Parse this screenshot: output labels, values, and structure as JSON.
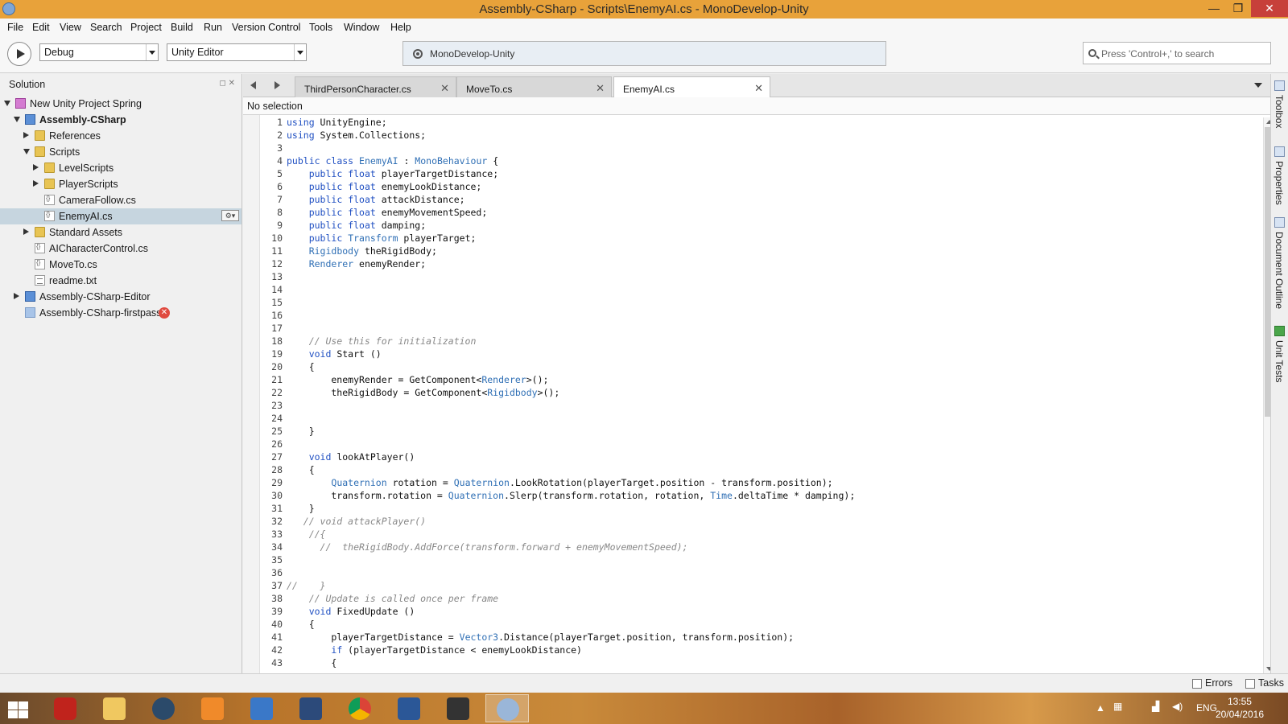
{
  "window": {
    "title": "Assembly-CSharp - Scripts\\EnemyAI.cs - MonoDevelop-Unity",
    "minimize": "—",
    "maximize": "❐",
    "close": "✕"
  },
  "menu": [
    "File",
    "Edit",
    "View",
    "Search",
    "Project",
    "Build",
    "Run",
    "Version Control",
    "Tools",
    "Window",
    "Help"
  ],
  "toolbar": {
    "config": "Debug",
    "target": "Unity Editor",
    "status": "MonoDevelop-Unity",
    "search_placeholder": "Press 'Control+,' to search"
  },
  "solution": {
    "title": "Solution",
    "pane_buttons": "◻ ✕",
    "gear": "⚙▾",
    "tree": [
      {
        "label": "New Unity Project Spring",
        "icon": "solution-icon",
        "depth": 0,
        "expander": "open",
        "bold": false
      },
      {
        "label": "Assembly-CSharp",
        "icon": "project-icon",
        "depth": 1,
        "expander": "open",
        "bold": true
      },
      {
        "label": "References",
        "icon": "folder-icon",
        "depth": 2,
        "expander": "closed",
        "bold": false
      },
      {
        "label": "Scripts",
        "icon": "folder-icon",
        "depth": 2,
        "expander": "open",
        "bold": false
      },
      {
        "label": "LevelScripts",
        "icon": "folder-icon",
        "depth": 3,
        "expander": "closed",
        "bold": false
      },
      {
        "label": "PlayerScripts",
        "icon": "folder-icon",
        "depth": 3,
        "expander": "closed",
        "bold": false
      },
      {
        "label": "CameraFollow.cs",
        "icon": "cs-file-icon",
        "depth": 3,
        "expander": "none",
        "bold": false
      },
      {
        "label": "EnemyAI.cs",
        "icon": "cs-file-icon",
        "depth": 3,
        "expander": "none",
        "bold": false,
        "selected": true
      },
      {
        "label": "Standard Assets",
        "icon": "folder-icon",
        "depth": 2,
        "expander": "closed",
        "bold": false
      },
      {
        "label": "AICharacterControl.cs",
        "icon": "cs-file-icon",
        "depth": 2,
        "expander": "none",
        "bold": false
      },
      {
        "label": "MoveTo.cs",
        "icon": "cs-file-icon",
        "depth": 2,
        "expander": "none",
        "bold": false
      },
      {
        "label": "readme.txt",
        "icon": "text-file-icon",
        "depth": 2,
        "expander": "none",
        "bold": false
      },
      {
        "label": "Assembly-CSharp-Editor",
        "icon": "project-icon",
        "depth": 1,
        "expander": "closed",
        "bold": false
      },
      {
        "label": "Assembly-CSharp-firstpass",
        "icon": "project-icon",
        "depth": 1,
        "expander": "none",
        "bold": false,
        "error": true
      }
    ],
    "error_glyph": "✕"
  },
  "tabs": [
    {
      "label": "ThirdPersonCharacter.cs",
      "active": false
    },
    {
      "label": "MoveTo.cs",
      "active": false
    },
    {
      "label": "EnemyAI.cs",
      "active": true
    }
  ],
  "tab_close_glyph": "✕",
  "breadcrumb": "No selection",
  "colors": {
    "keyword": "#1f4fc2",
    "type": "#2f6fb5",
    "comment": "#888888",
    "titlebar": "#e8a23a",
    "selection": "#c6d5df"
  },
  "code": [
    {
      "n": "1",
      "t": "using UnityEngine;"
    },
    {
      "n": "2",
      "t": "using System.Collections;"
    },
    {
      "n": "3",
      "t": ""
    },
    {
      "n": "4",
      "t": "public class EnemyAI : MonoBehaviour {"
    },
    {
      "n": "5",
      "t": "    public float playerTargetDistance;"
    },
    {
      "n": "6",
      "t": "    public float enemyLookDistance;"
    },
    {
      "n": "7",
      "t": "    public float attackDistance;"
    },
    {
      "n": "8",
      "t": "    public float enemyMovementSpeed;"
    },
    {
      "n": "9",
      "t": "    public float damping;"
    },
    {
      "n": "10",
      "t": "    public Transform playerTarget;"
    },
    {
      "n": "11",
      "t": "    Rigidbody theRigidBody;"
    },
    {
      "n": "12",
      "t": "    Renderer enemyRender;"
    },
    {
      "n": "13",
      "t": ""
    },
    {
      "n": "14",
      "t": ""
    },
    {
      "n": "15",
      "t": ""
    },
    {
      "n": "16",
      "t": ""
    },
    {
      "n": "17",
      "t": ""
    },
    {
      "n": "18",
      "t": "    // Use this for initialization",
      "comment": true
    },
    {
      "n": "19",
      "t": "    void Start ()"
    },
    {
      "n": "20",
      "t": "    {"
    },
    {
      "n": "21",
      "t": "        enemyRender = GetComponent<Renderer>();"
    },
    {
      "n": "22",
      "t": "        theRigidBody = GetComponent<Rigidbody>();"
    },
    {
      "n": "23",
      "t": ""
    },
    {
      "n": "24",
      "t": ""
    },
    {
      "n": "25",
      "t": "    }"
    },
    {
      "n": "26",
      "t": ""
    },
    {
      "n": "27",
      "t": "    void lookAtPlayer()"
    },
    {
      "n": "28",
      "t": "    {"
    },
    {
      "n": "29",
      "t": "        Quaternion rotation = Quaternion.LookRotation(playerTarget.position - transform.position);"
    },
    {
      "n": "30",
      "t": "        transform.rotation = Quaternion.Slerp(transform.rotation, rotation, Time.deltaTime * damping);"
    },
    {
      "n": "31",
      "t": "    }"
    },
    {
      "n": "32",
      "t": "   // void attackPlayer()",
      "comment": true
    },
    {
      "n": "33",
      "t": "    //{",
      "comment": true
    },
    {
      "n": "34",
      "t": "      //  theRigidBody.AddForce(transform.forward + enemyMovementSpeed);",
      "comment": true
    },
    {
      "n": "35",
      "t": ""
    },
    {
      "n": "36",
      "t": ""
    },
    {
      "n": "37",
      "t": "//    }",
      "comment": true
    },
    {
      "n": "38",
      "t": "    // Update is called once per frame",
      "comment": true
    },
    {
      "n": "39",
      "t": "    void FixedUpdate ()"
    },
    {
      "n": "40",
      "t": "    {"
    },
    {
      "n": "41",
      "t": "        playerTargetDistance = Vector3.Distance(playerTarget.position, transform.position);"
    },
    {
      "n": "42",
      "t": "        if (playerTargetDistance < enemyLookDistance)"
    },
    {
      "n": "43",
      "t": "        {"
    }
  ],
  "right_dock": [
    {
      "label": "Toolbox",
      "icon": "toolbox-icon"
    },
    {
      "label": "Properties",
      "icon": "properties-icon"
    },
    {
      "label": "Document Outline",
      "icon": "document-outline-icon"
    },
    {
      "label": "Unit Tests",
      "icon": "unit-tests-icon"
    }
  ],
  "statusbar": {
    "errors": "Errors",
    "tasks": "Tasks"
  },
  "taskbar": {
    "apps": [
      "power-app",
      "file-explorer",
      "steam",
      "media-player",
      "control-panel",
      "blender",
      "chrome",
      "word",
      "unity",
      "monodevelop"
    ],
    "tray_language": "ENG",
    "time": "13:55",
    "date": "20/04/2016"
  }
}
